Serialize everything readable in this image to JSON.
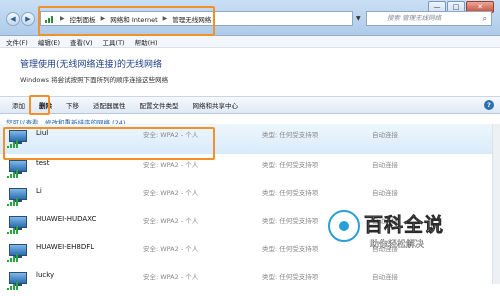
{
  "titlebar": {
    "breadcrumb": [
      "控制面板",
      "网络和 Internet",
      "管理无线网络"
    ],
    "search_placeholder": "搜索 管理无线网络",
    "window_buttons": [
      "—",
      "□",
      "✕"
    ]
  },
  "menu": [
    "文件(F)",
    "编辑(E)",
    "查看(V)",
    "工具(T)",
    "帮助(H)"
  ],
  "header": {
    "title": "管理使用(无线网络连接)的无线网络",
    "subtitle": "Windows 将尝试按照下面所列的顺序连接这些网络"
  },
  "toolbar": [
    "添加",
    "删除",
    "下移",
    "适配器属性",
    "配置文件类型",
    "网络和共享中心"
  ],
  "hint": "您可以查看、修改和重新排序的网络 (24)",
  "networks": [
    {
      "name": "Liul",
      "security": "安全: WPA2 - 个人",
      "type": "类型: 任何受支持项",
      "mode": "自动连接"
    },
    {
      "name": "test",
      "security": "安全: WPA2 - 个人",
      "type": "类型: 任何受支持项",
      "mode": "自动连接"
    },
    {
      "name": "Li",
      "security": "安全: WPA2 - 个人",
      "type": "类型: 任何受支持项",
      "mode": "自动连接"
    },
    {
      "name": "HUAWEI-HUDAXC",
      "security": "安全: WPA2 - 个人",
      "type": "类型: 任何受支持项",
      "mode": "自动连接"
    },
    {
      "name": "HUAWEI-EH8DFL",
      "security": "安全: WPA2 - 个人",
      "type": "类型: 任何受支持项",
      "mode": "自动连接"
    },
    {
      "name": "lucky",
      "security": "安全: WPA2 - 个人",
      "type": "类型: 任何受支持项",
      "mode": "自动连接"
    }
  ],
  "watermark": {
    "main": "百科全说",
    "sub": "助你轻松解决"
  },
  "colors": {
    "highlight": "#f2902a",
    "title_blue": "#1e3f8a",
    "link_blue": "#1f5fa8"
  }
}
